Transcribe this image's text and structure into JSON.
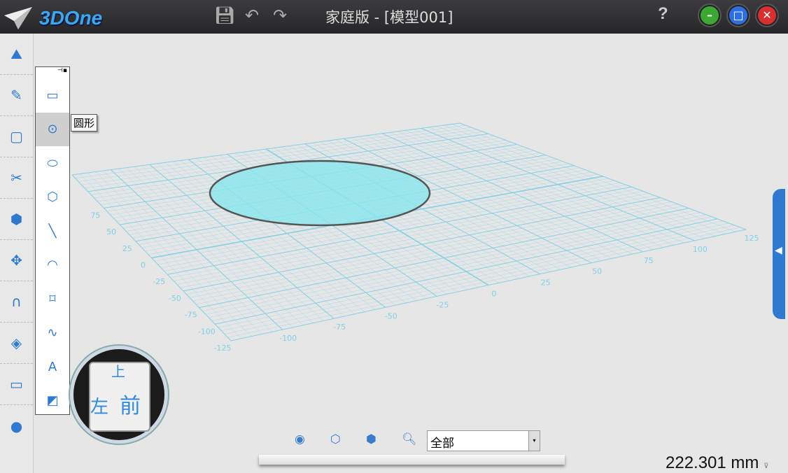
{
  "app": {
    "logo": "3DOne",
    "title": "家庭版 - [模型001]",
    "help": "?"
  },
  "toolbar": {
    "icons": [
      "save-icon",
      "undo-icon",
      "redo-icon"
    ]
  },
  "window": {
    "minimize": "–",
    "maximize": "□",
    "close": "✕"
  },
  "sidebar": {
    "items": [
      "basic-solid",
      "sketch-draw",
      "sketch-edit",
      "special-function",
      "feature-modeling",
      "move",
      "combine",
      "special-modeling",
      "measure",
      "material-render"
    ]
  },
  "flyout": {
    "tooltip": "圆形",
    "items": [
      "rectangle",
      "circle",
      "ellipse",
      "polygon",
      "line",
      "arc",
      "fillet",
      "spline",
      "text",
      "reference-geometry"
    ],
    "selected": 1
  },
  "viewcube": {
    "top": "上",
    "left": "左",
    "front": "前"
  },
  "bottom": {
    "filter_value": "全部",
    "measure_value": "222.301 mm"
  },
  "grid": {
    "range": [
      -125,
      125
    ],
    "left_labels": [
      "75",
      "50",
      "25",
      "0",
      "-25",
      "-50",
      "-75",
      "-100",
      "-125"
    ],
    "bottom_labels": [
      "-100",
      "-75",
      "-50",
      "-25",
      "0",
      "25",
      "50",
      "75",
      "100",
      "125"
    ]
  },
  "colors": {
    "accent": "#2f7ad0",
    "grid": "#7fd0e8",
    "fill": "#8ae6ee"
  }
}
